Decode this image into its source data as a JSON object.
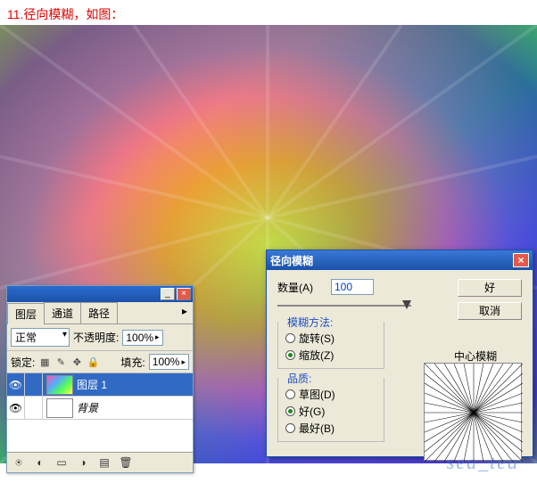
{
  "caption": "11.径向模糊，如图：",
  "layers_panel": {
    "tabs": [
      "图层",
      "通道",
      "路径"
    ],
    "blend_label": "正常",
    "opacity_label": "不透明度:",
    "opacity_value": "100%",
    "lock_label": "锁定:",
    "fill_label": "填充:",
    "fill_value": "100%",
    "layers": [
      {
        "name": "图层 1",
        "selected": true
      },
      {
        "name": "背景",
        "selected": false
      }
    ]
  },
  "dialog": {
    "title": "径向模糊",
    "amount_label": "数量(A)",
    "amount_value": "100",
    "ok": "好",
    "cancel": "取消",
    "method_legend": "模糊方法:",
    "method_rotate": "旋转(S)",
    "method_zoom": "缩放(Z)",
    "quality_legend": "品质:",
    "quality_draft": "草图(D)",
    "quality_good": "好(G)",
    "quality_best": "最好(B)",
    "preview_label": "中心模糊"
  },
  "watermark": "sea_tea"
}
